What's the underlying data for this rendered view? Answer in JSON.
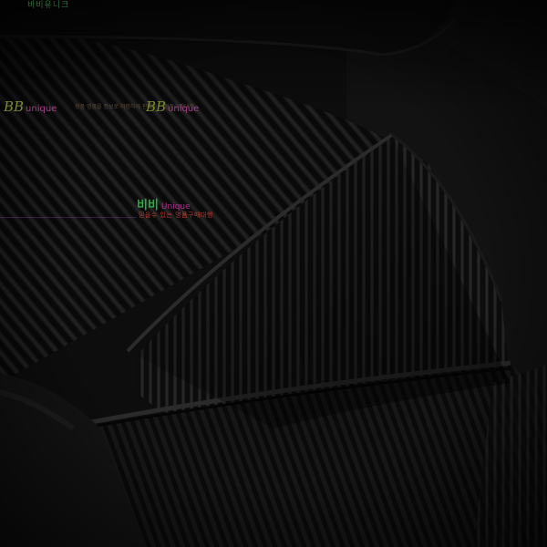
{
  "image": {
    "description_kind": "close-up product photo of black ribbed knit fabric",
    "colors": {
      "fabric": "#111111",
      "rib_highlight": "#2a2a2a",
      "rib_shadow": "#000000",
      "watermark_green": "#2ea84a",
      "watermark_purple": "#b03090",
      "watermark_red": "#c0392b",
      "watermark_olive": "#7a8a2a"
    }
  },
  "watermarks": {
    "top_text": "비비유니크",
    "logo_letters": "BB",
    "logo_suffix": "unique",
    "tagline_small": "정품 명품을 정보로 저렴하게 판매하는 정품구매대행",
    "center_brand": "비비",
    "center_brand_suffix": "Unique",
    "center_tagline": "믿을수 있는 명품구매대행"
  }
}
